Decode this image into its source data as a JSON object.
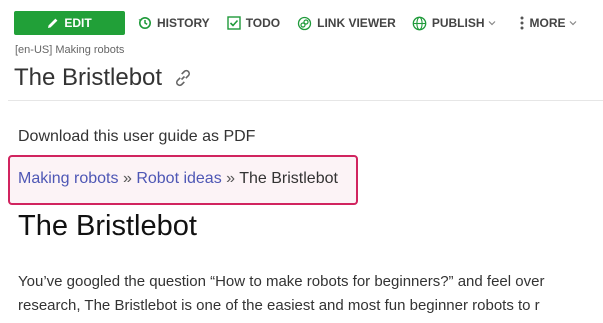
{
  "toolbar": {
    "edit_label": "EDIT",
    "history_label": "HISTORY",
    "todo_label": "TODO",
    "link_viewer_label": "LINK VIEWER",
    "publish_label": "PUBLISH",
    "more_label": "MORE"
  },
  "header": {
    "breadcrumb": "[en-US] Making robots",
    "title": "The Bristlebot"
  },
  "article": {
    "download_link": "Download this user guide as PDF",
    "breadcrumbs": [
      {
        "label": "Making robots"
      },
      {
        "label": "Robot ideas"
      },
      {
        "label": "The Bristlebot"
      }
    ],
    "separator": "»",
    "title": "The Bristlebot",
    "paragraph_lines": [
      "You’ve googled the question “How to make robots for beginners?” and feel over",
      "research, The Bristlebot is one of the easiest and most fun beginner robots to r"
    ]
  },
  "colors": {
    "edit_button": "#21a038",
    "highlight_border": "#d1245f",
    "link": "#4e57b5"
  },
  "icons": {
    "edit": "pencil-icon",
    "history": "history-icon",
    "todo": "checkbox-icon",
    "link_viewer": "link-viewer-icon",
    "publish": "globe-icon",
    "more": "vertical-dots-icon",
    "title_link": "link-icon"
  }
}
